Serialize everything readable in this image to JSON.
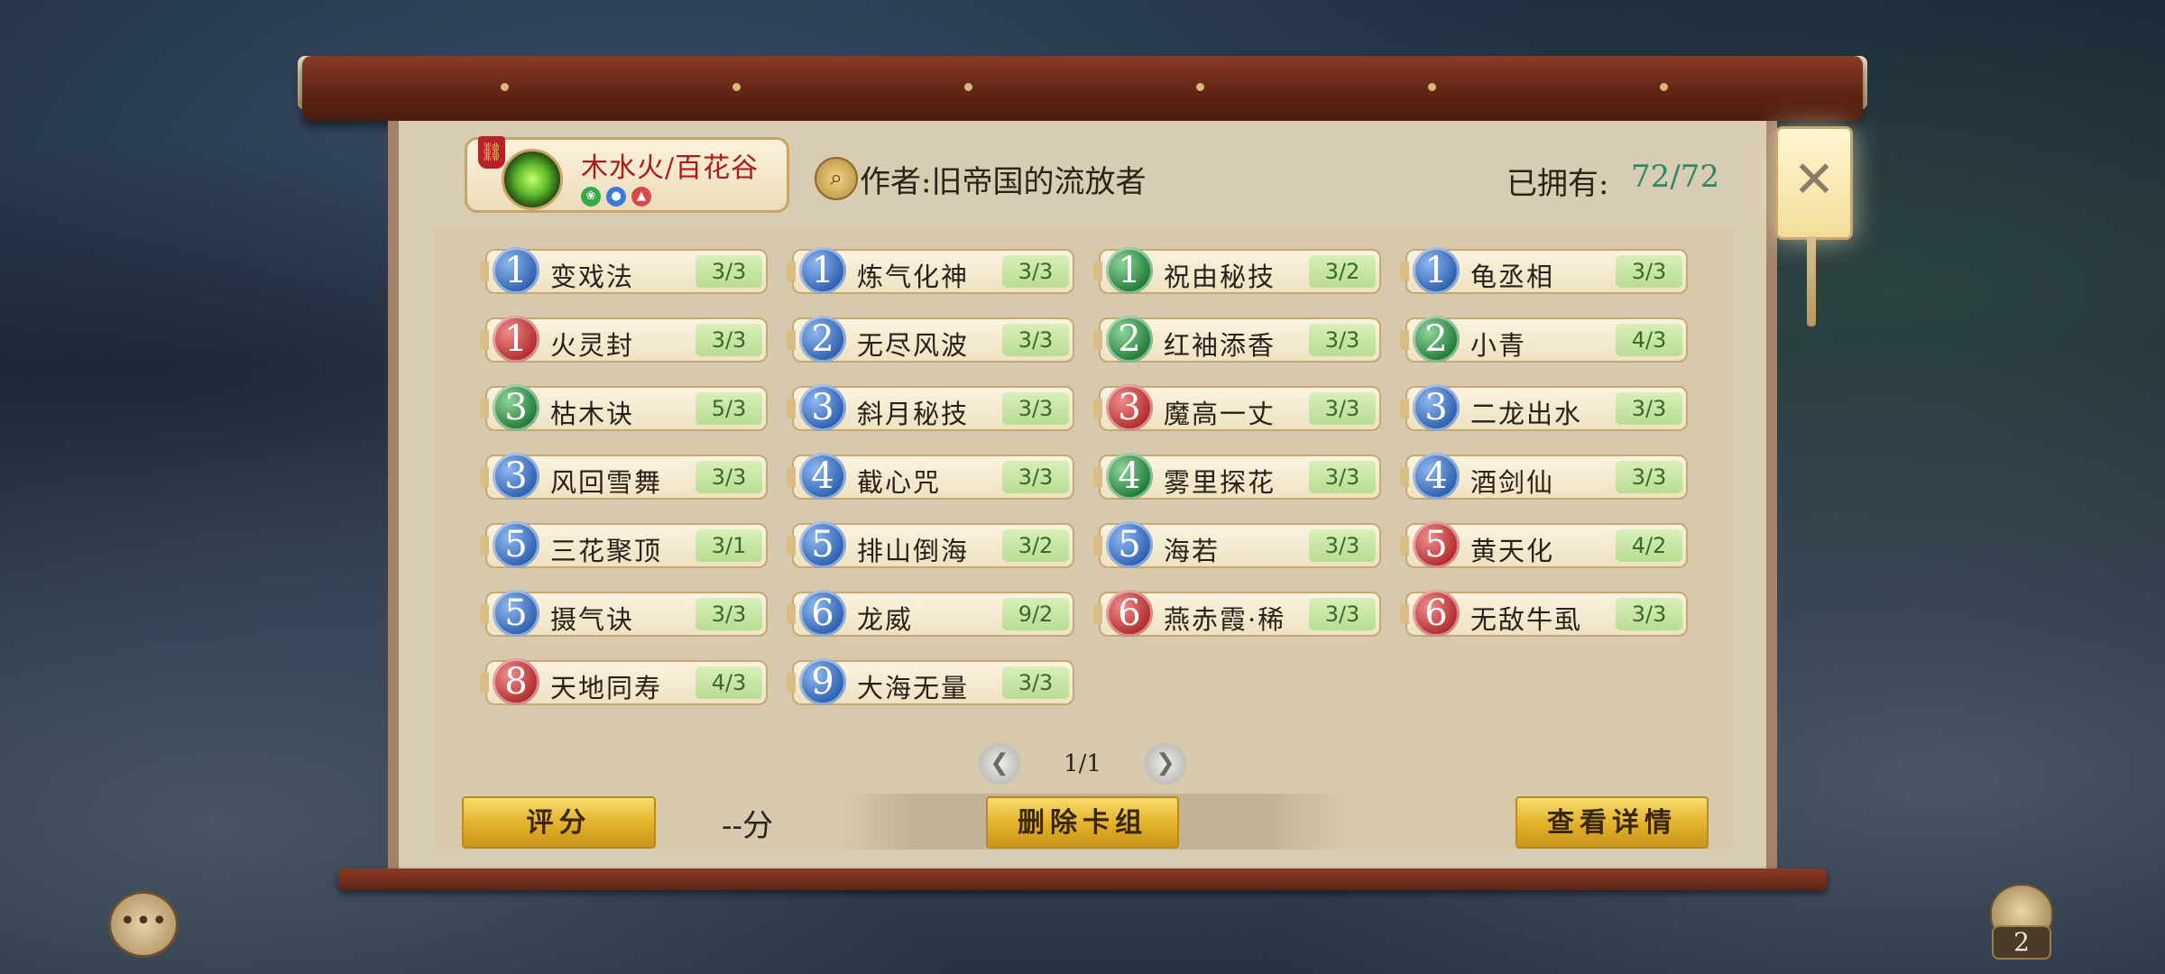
{
  "deck": {
    "name": "木水火/百花谷",
    "tag_icon": "link-icon",
    "elements": [
      {
        "icon": "wood-element-icon",
        "glyph": "❀",
        "color": "#3aa84a"
      },
      {
        "icon": "water-element-icon",
        "glyph": "💧",
        "color": "#3a7ad8"
      },
      {
        "icon": "fire-element-icon",
        "glyph": "🔥",
        "color": "#d84a4a"
      }
    ]
  },
  "author": {
    "icon": "magnifier-icon",
    "label": "作者:旧帝国的流放者"
  },
  "owned": {
    "label": "已拥有:",
    "value": "72/72"
  },
  "cards": [
    {
      "cost": "1",
      "color": "blue",
      "name": "变戏法",
      "count": "3/3"
    },
    {
      "cost": "1",
      "color": "blue",
      "name": "炼气化神",
      "count": "3/3"
    },
    {
      "cost": "1",
      "color": "green",
      "name": "祝由秘技",
      "count": "3/2"
    },
    {
      "cost": "1",
      "color": "blue",
      "name": "龟丞相",
      "count": "3/3"
    },
    {
      "cost": "1",
      "color": "red",
      "name": "火灵封",
      "count": "3/3"
    },
    {
      "cost": "2",
      "color": "blue",
      "name": "无尽风波",
      "count": "3/3"
    },
    {
      "cost": "2",
      "color": "green",
      "name": "红袖添香",
      "count": "3/3"
    },
    {
      "cost": "2",
      "color": "green",
      "name": "小青",
      "count": "4/3"
    },
    {
      "cost": "3",
      "color": "green",
      "name": "枯木诀",
      "count": "5/3"
    },
    {
      "cost": "3",
      "color": "blue",
      "name": "斜月秘技",
      "count": "3/3"
    },
    {
      "cost": "3",
      "color": "red",
      "name": "魔高一丈",
      "count": "3/3"
    },
    {
      "cost": "3",
      "color": "blue",
      "name": "二龙出水",
      "count": "3/3"
    },
    {
      "cost": "3",
      "color": "blue",
      "name": "风回雪舞",
      "count": "3/3"
    },
    {
      "cost": "4",
      "color": "blue",
      "name": "截心咒",
      "count": "3/3"
    },
    {
      "cost": "4",
      "color": "green",
      "name": "雾里探花",
      "count": "3/3"
    },
    {
      "cost": "4",
      "color": "blue",
      "name": "酒剑仙",
      "count": "3/3"
    },
    {
      "cost": "5",
      "color": "blue",
      "name": "三花聚顶",
      "count": "3/1"
    },
    {
      "cost": "5",
      "color": "blue",
      "name": "排山倒海",
      "count": "3/2"
    },
    {
      "cost": "5",
      "color": "blue",
      "name": "海若",
      "count": "3/3"
    },
    {
      "cost": "5",
      "color": "red",
      "name": "黄天化",
      "count": "4/2"
    },
    {
      "cost": "5",
      "color": "blue",
      "name": "摄气诀",
      "count": "3/3"
    },
    {
      "cost": "6",
      "color": "blue",
      "name": "龙威",
      "count": "9/2"
    },
    {
      "cost": "6",
      "color": "red",
      "name": "燕赤霞·稀",
      "count": "3/3"
    },
    {
      "cost": "6",
      "color": "red",
      "name": "无敌牛虱",
      "count": "3/3"
    },
    {
      "cost": "8",
      "color": "red",
      "name": "天地同寿",
      "count": "4/3"
    },
    {
      "cost": "9",
      "color": "blue",
      "name": "大海无量",
      "count": "3/3"
    }
  ],
  "pager": {
    "label": "1/1",
    "prev_icon": "chevron-left-icon",
    "next_icon": "chevron-right-icon"
  },
  "actions": {
    "rate_label": "评分",
    "score_value": "--分",
    "delete_label": "删除卡组",
    "details_label": "查看详情"
  },
  "close_icon": "close-icon",
  "chat_icon": "chat-icon",
  "bag": {
    "icon": "bag-icon",
    "count": "2"
  }
}
